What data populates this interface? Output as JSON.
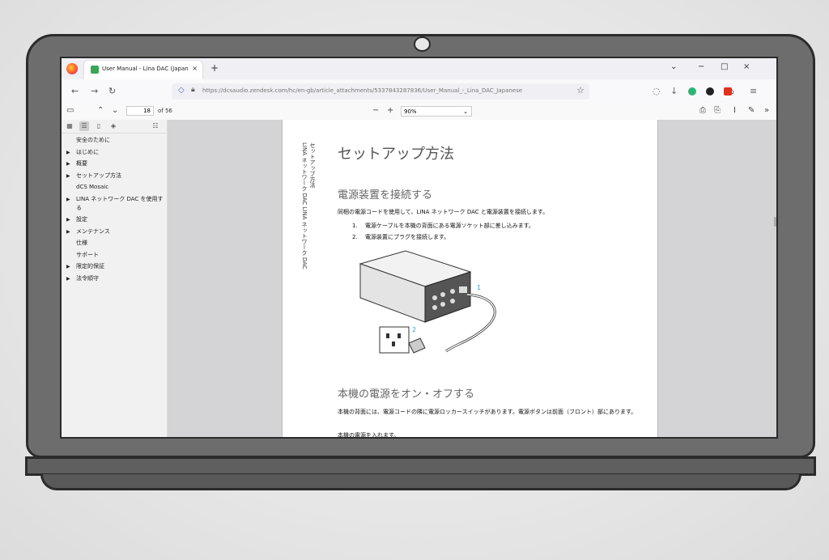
{
  "browser": {
    "tab_title": "User Manual - Lina DAC (Japan",
    "tab_close": "×",
    "new_tab": "+",
    "url": "https://dcsaudio.zendesk.com/hc/en-gb/article_attachments/5337843287836/User_Manual_-_Lina_DAC_Japanese",
    "win_min": "−",
    "win_max": "□",
    "win_close": "×",
    "chevron": "⌄"
  },
  "pdf_toolbar": {
    "page_number": "18",
    "page_total": "of 56",
    "zoom_out": "−",
    "zoom_in": "+",
    "zoom_value": "90%"
  },
  "outline": [
    {
      "label": "安全のために",
      "expandable": false
    },
    {
      "label": "はじめに",
      "expandable": true
    },
    {
      "label": "概要",
      "expandable": true
    },
    {
      "label": "セットアップ方法",
      "expandable": true
    },
    {
      "label": "dCS Mosaic",
      "expandable": false
    },
    {
      "label": "LINA ネットワーク DAC を使用する",
      "expandable": true
    },
    {
      "label": "設定",
      "expandable": true
    },
    {
      "label": "メンテナンス",
      "expandable": true
    },
    {
      "label": "仕様",
      "expandable": false
    },
    {
      "label": "サポート",
      "expandable": false
    },
    {
      "label": "限定的保証",
      "expandable": true
    },
    {
      "label": "法令順守",
      "expandable": true
    }
  ],
  "document": {
    "side_header_1": "セットアップ方法",
    "side_header_2": "LINA ネットワーク DAC LINA ネットワーク DAC",
    "title": "セットアップ方法",
    "section1_heading": "電源装置を接続する",
    "section1_intro": "同梱の電源コードを使用して、LINA ネットワーク DAC と電源装置を接続します。",
    "steps": [
      {
        "num": "1.",
        "text": "電源ケーブルを本機の背面にある電源ソケット部に差し込みます。"
      },
      {
        "num": "2.",
        "text": "電源装置にプラグを接続します。"
      }
    ],
    "callout_1": "1",
    "callout_2": "2",
    "section2_heading": "本機の電源をオン・オフする",
    "section2_text": "本機の背面には、電源コードの隣に電源ロッカースイッチがあります。電源ボタンは前面（フロント）部にあります。",
    "section2_text2": "本機の電源を入れます。"
  }
}
